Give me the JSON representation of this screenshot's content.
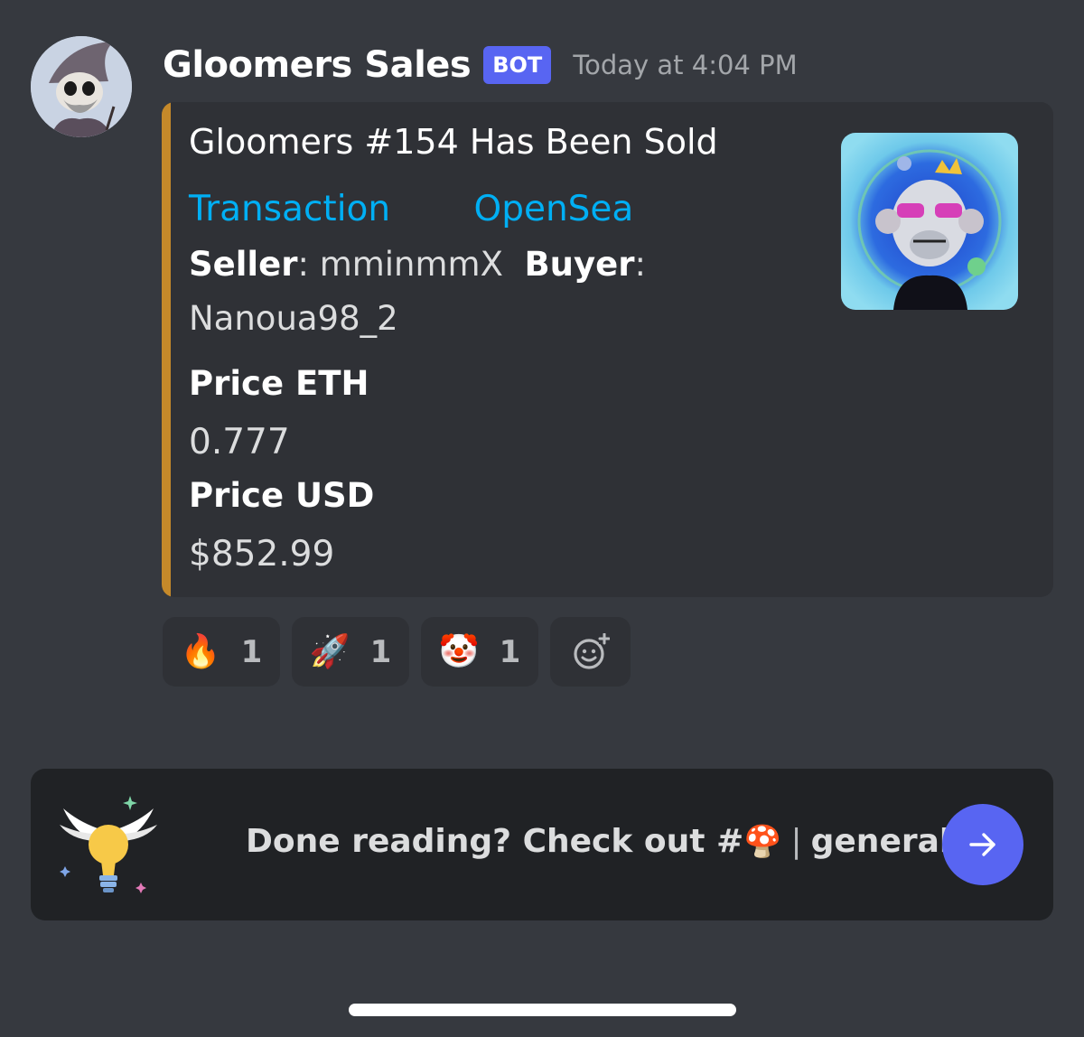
{
  "message": {
    "author": "Gloomers Sales",
    "bot_tag": "BOT",
    "timestamp": "Today at 4:04 PM"
  },
  "embed": {
    "accent_color": "#c5892a",
    "title": "Gloomers #154 Has Been Sold",
    "link_transaction": "Transaction",
    "link_opensea": "OpenSea",
    "seller_label": "Seller",
    "seller_value": "mminmmX",
    "buyer_label": "Buyer",
    "buyer_value": "Nanoua98_2",
    "fields": [
      {
        "name": "Price ETH",
        "value": "0.777"
      },
      {
        "name": "Price USD",
        "value": "$852.99"
      }
    ]
  },
  "reactions": [
    {
      "emoji": "🔥",
      "count": "1",
      "icon": "fire-icon"
    },
    {
      "emoji": "🚀",
      "count": "1",
      "icon": "rocket-icon"
    },
    {
      "emoji": "🤡",
      "count": "1",
      "icon": "clown-icon"
    }
  ],
  "add_reaction_icon": "add-reaction-icon",
  "banner": {
    "text_before": "Done reading? Check out #",
    "channel_emoji": "🍄",
    "separator": "|",
    "channel_name": "general.",
    "button_icon": "arrow-right-icon"
  },
  "colors": {
    "background": "#36393f",
    "embed_background": "#2f3136",
    "link": "#00aff4",
    "blurple": "#5865f2"
  }
}
